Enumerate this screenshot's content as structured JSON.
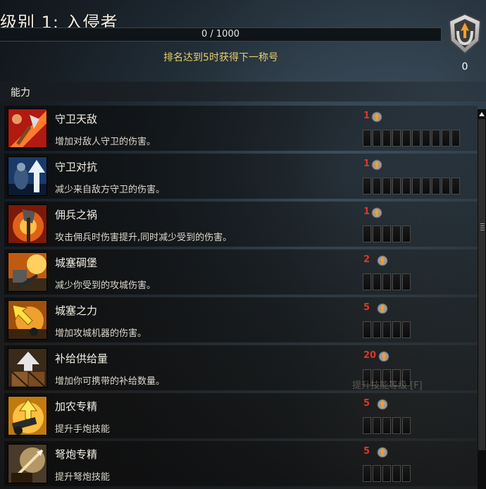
{
  "header": {
    "title": "级别 1: 入侵者",
    "progress_text": "0 / 1000",
    "progress_fraction": 0,
    "rank_message": "排名达到5时获得下一称号",
    "points": "0"
  },
  "section": {
    "title": "能力"
  },
  "abilities": [
    {
      "name": "守卫天敌",
      "desc": "增加对敌人守卫的伤害。",
      "cost": "1",
      "slots": 10,
      "icon": "axe-slash-icon"
    },
    {
      "name": "守卫对抗",
      "desc": "减少来自敌方守卫的伤害。",
      "cost": "1",
      "slots": 10,
      "icon": "armored-guard-arrow-icon"
    },
    {
      "name": "佣兵之祸",
      "desc": "攻击佣兵时伤害提升,同时减少受到的伤害。",
      "cost": "1",
      "slots": 5,
      "icon": "axe-fire-icon"
    },
    {
      "name": "城塞碉堡",
      "desc": "减少你受到的攻城伤害。",
      "cost": "2",
      "slots": 5,
      "icon": "siege-fortress-icon"
    },
    {
      "name": "城塞之力",
      "desc": "增加攻城机器的伤害。",
      "cost": "5",
      "slots": 5,
      "icon": "siege-arrow-icon"
    },
    {
      "name": "补给供给量",
      "desc": "增加你可携带的补给数量。",
      "cost": "20",
      "slots": 5,
      "icon": "supply-crate-icon"
    },
    {
      "name": "加农专精",
      "desc": "提升手炮技能",
      "cost": "5",
      "slots": 5,
      "icon": "cannon-icon"
    },
    {
      "name": "弩炮专精",
      "desc": "提升弩炮技能",
      "cost": "5",
      "slots": 5,
      "icon": "ballista-icon"
    }
  ],
  "ghost_text": "提升技能等级 [F]",
  "colors": {
    "accent": "#e8cf6a",
    "cost_red": "#e0352c",
    "coin_orange": "#f0a030"
  }
}
